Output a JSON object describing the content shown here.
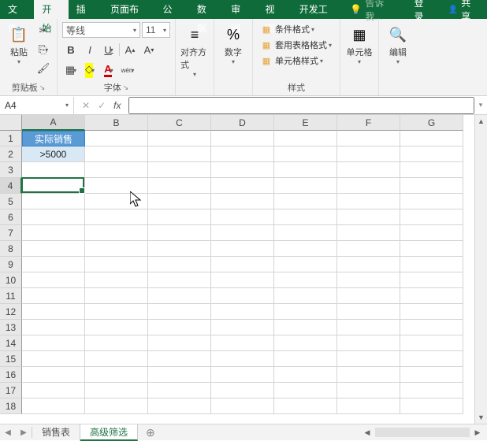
{
  "tabs": {
    "file": "文件",
    "home": "开始",
    "insert": "插入",
    "page_layout": "页面布局",
    "formulas": "公式",
    "data": "数据",
    "review": "审阅",
    "view": "视图",
    "developer": "开发工具",
    "tell_me": "告诉我...",
    "login": "登录",
    "share": "共享"
  },
  "ribbon": {
    "clipboard": {
      "label": "剪贴板",
      "paste": "粘贴"
    },
    "font": {
      "label": "字体",
      "name": "等线",
      "size": "11",
      "bold": "B",
      "italic": "I",
      "underline": "U"
    },
    "alignment": {
      "label": "对齐方式"
    },
    "number": {
      "label": "数字"
    },
    "styles": {
      "label": "样式",
      "cond": "条件格式",
      "table": "套用表格格式",
      "cell": "单元格样式"
    },
    "cells": {
      "label": "单元格"
    },
    "editing": {
      "label": "编辑"
    }
  },
  "namebox": "A4",
  "fx": "fx",
  "columns": [
    "A",
    "B",
    "C",
    "D",
    "E",
    "F",
    "G"
  ],
  "rows": [
    "1",
    "2",
    "3",
    "4",
    "5",
    "6",
    "7",
    "8",
    "9",
    "10",
    "11",
    "12",
    "13",
    "14",
    "15",
    "16",
    "17",
    "18"
  ],
  "data": {
    "A1": "实际销售",
    "A2": ">5000"
  },
  "active_cell": {
    "row": 4,
    "col": 1
  },
  "sheets": {
    "sheet1": "销售表",
    "sheet2": "高级筛选",
    "active": "sheet2"
  },
  "chart_data": {
    "type": "table",
    "columns": [
      "实际销售"
    ],
    "rows": [
      [
        ">5000"
      ]
    ]
  }
}
